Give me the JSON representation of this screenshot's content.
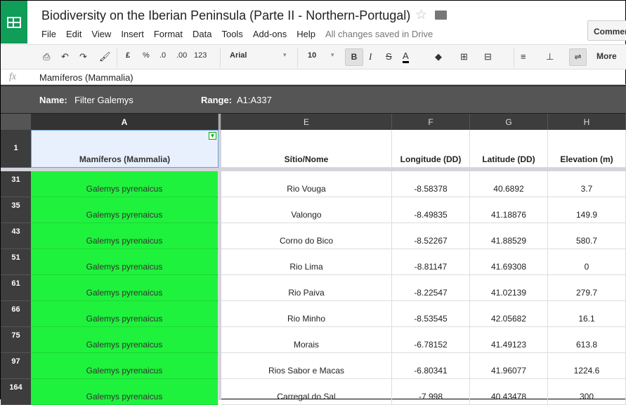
{
  "app": {
    "title": "Biodiversity on the Iberian Peninsula (Parte II - Northern-Portugal)",
    "saved_status": "All changes saved in Drive",
    "comments_label": "Comments",
    "brand_color": "#0f9d58"
  },
  "menu": [
    "File",
    "Edit",
    "View",
    "Insert",
    "Format",
    "Data",
    "Tools",
    "Add-ons",
    "Help"
  ],
  "toolbar": {
    "currency": "£",
    "percent": "%",
    "dec_less": ".0",
    "dec_more": ".00",
    "format_more": "123",
    "font": "Arial",
    "size": "10",
    "bold": "B",
    "italic": "I",
    "strike": "S",
    "text_color": "A",
    "more": "More"
  },
  "formula": {
    "label": "fx",
    "value": "Mamíferos (Mammalia)"
  },
  "filter": {
    "name_label": "Name:",
    "name": "Filter Galemys",
    "range_label": "Range:",
    "range": "A1:A337"
  },
  "columns": [
    "A",
    "E",
    "F",
    "G",
    "H"
  ],
  "header_row": {
    "num": "1",
    "cells": [
      "Mamíferos (Mammalia)",
      "Sítio/Nome",
      "Longitude (DD)",
      "Latitude (DD)",
      "Elevation (m)"
    ]
  },
  "rows": [
    {
      "num": "31",
      "cells": [
        "Galemys pyrenaicus",
        "Rio Vouga",
        "-8.58378",
        "40.6892",
        "3.7"
      ]
    },
    {
      "num": "35",
      "cells": [
        "Galemys pyrenaicus",
        "Valongo",
        "-8.49835",
        "41.18876",
        "149.9"
      ]
    },
    {
      "num": "43",
      "cells": [
        "Galemys pyrenaicus",
        "Corno do Bico",
        "-8.52267",
        "41.88529",
        "580.7"
      ]
    },
    {
      "num": "51",
      "cells": [
        "Galemys pyrenaicus",
        "Rio Lima",
        "-8.81147",
        "41.69308",
        "0"
      ]
    },
    {
      "num": "61",
      "cells": [
        "Galemys pyrenaicus",
        "Rio Paiva",
        "-8.22547",
        "41.02139",
        "279.7"
      ]
    },
    {
      "num": "66",
      "cells": [
        "Galemys pyrenaicus",
        "Rio Minho",
        "-8.53545",
        "42.05682",
        "16.1"
      ]
    },
    {
      "num": "75",
      "cells": [
        "Galemys pyrenaicus",
        "Morais",
        "-6.78152",
        "41.49123",
        "613.8"
      ]
    },
    {
      "num": "97",
      "cells": [
        "Galemys pyrenaicus",
        "Rios Sabor e Macas",
        "-6.80341",
        "41.96077",
        "1224.6"
      ]
    },
    {
      "num": "164",
      "cells": [
        "Galemys pyrenaicus",
        "Carregal do Sal",
        "-7.998",
        "40.43478",
        "300"
      ]
    }
  ],
  "highlight_color": "#1ff23c"
}
